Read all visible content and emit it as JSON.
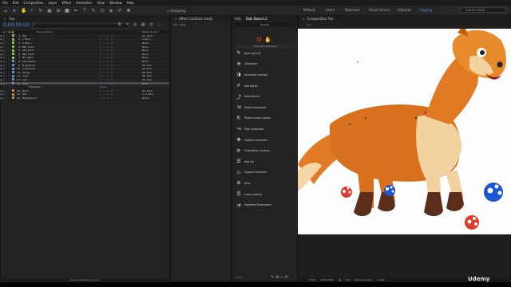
{
  "menu": [
    "File",
    "Edit",
    "Composition",
    "Layer",
    "Effect",
    "Animation",
    "View",
    "Window",
    "Help"
  ],
  "toolbar": {
    "snapping_label": "Snapping"
  },
  "workspaces": [
    "Default",
    "Learn",
    "Standard",
    "Small Screen",
    "Libraries",
    "Rigging"
  ],
  "active_workspace": "Rigging",
  "search_help": "Search Help",
  "timeline": {
    "tab": "Fox",
    "timecode": "0:00:00:00",
    "columns": {
      "source": "Source Name",
      "parent": "Parent & Link"
    },
    "layers": [
      {
        "num": "1",
        "name": "Tail",
        "parent": "41. body",
        "color": "#8fbf5a"
      },
      {
        "num": "2",
        "name": "L Tail 2",
        "parent": "L Tail 1",
        "color": "#8fbf5a"
      },
      {
        "num": "3",
        "name": "C Tail 1",
        "parent": "None",
        "color": "#8fbf5a"
      },
      {
        "num": "4",
        "name": "BB | Front",
        "parent": "None",
        "color": "#8fbf5a"
      },
      {
        "num": "5",
        "name": "LB | Front",
        "parent": "None",
        "color": "#8fbf5a"
      },
      {
        "num": "6",
        "name": "RB | Front",
        "parent": "None",
        "color": "#8fbf5a"
      },
      {
        "num": "7",
        "name": "BF | Back",
        "parent": "None",
        "color": "#8fbf5a"
      },
      {
        "num": "8",
        "name": "[Armature]",
        "parent": "None",
        "color": "#6b8fbf"
      },
      {
        "num": "9",
        "name": "R_Eyebrow",
        "parent": "46. face",
        "color": "#6b8fbf"
      },
      {
        "num": "10",
        "name": "L_Eyebrow",
        "parent": "46. face",
        "color": "#6b8fbf"
      },
      {
        "num": "11",
        "name": "[Face]",
        "parent": "46. face",
        "color": "#6b8fbf"
      },
      {
        "num": "12",
        "name": "nose",
        "parent": "46. face",
        "color": "#6b8fbf"
      },
      {
        "num": "13",
        "name": "eye",
        "parent": "46. face",
        "color": "#6b8fbf"
      },
      {
        "num": "14",
        "name": "body",
        "parent": "None",
        "color": "#6b8fbf",
        "selected": true
      },
      {
        "num": "",
        "name": "Transform",
        "parent": "Reset",
        "color": "#232323",
        "sub": true
      },
      {
        "num": "40",
        "name": "Neck",
        "parent": "41. body",
        "color": "#c88a3c"
      },
      {
        "num": "41",
        "name": "Tail",
        "parent": "1. C Tail 1",
        "color": "#c88a3c"
      },
      {
        "num": "42",
        "name": "Background",
        "parent": "None",
        "color": "#c88a3c"
      }
    ],
    "bottom_label": "Toggle Switches / Modes"
  },
  "effect_controls": {
    "tab": "Effect Controls: body",
    "subtitle": "Fox · body"
  },
  "panels": {
    "info_tab": "Info",
    "duik_tab": "Duik Bassel.2"
  },
  "duik": {
    "title": "Rigging",
    "section": "Links & Constraints",
    "buttons": [
      {
        "label": "Auto-rig & IK",
        "icon": "✎"
      },
      {
        "label": "Connector",
        "icon": "✣"
      },
      {
        "label": "Animation blender",
        "icon": "◑"
      },
      {
        "label": "Add bones",
        "icon": "✐"
      },
      {
        "label": "Auto-Parent",
        "icon": "⤴"
      },
      {
        "label": "Parent constraint",
        "icon": "⇲"
      },
      {
        "label": "Parent across comps",
        "icon": "⇱"
      },
      {
        "label": "Path constraint",
        "icon": "↝"
      },
      {
        "label": "Position constraint",
        "icon": "✥"
      },
      {
        "label": "Orientation constra...",
        "icon": "⟳"
      },
      {
        "label": "Add list",
        "icon": "☰"
      },
      {
        "label": "Expose transform",
        "icon": "◇"
      },
      {
        "label": "Zero",
        "icon": "⊘"
      },
      {
        "label": "Lock property",
        "icon": "⚿"
      },
      {
        "label": "Separate Dimensions",
        "icon": "⇉"
      }
    ],
    "footer_left": "1.0.0"
  },
  "composition": {
    "tab": "Composition Fox",
    "subtab": "Fox"
  },
  "comp_footer": {
    "zoom": "100%",
    "timecode": "0:00:00:00",
    "quality": "Full",
    "camera": "Active Camera",
    "views": "1 View"
  },
  "watermark": "Udemy",
  "colors": {
    "accent": "#3e8fe0",
    "selected_layer": "#4a4a4a",
    "duik_logo": "#d43b2c",
    "fox_orange": "#d9701e",
    "fox_cream": "#f2d3a0",
    "paw_blue": "#1a55d6",
    "paw_red": "#e03a2a"
  }
}
